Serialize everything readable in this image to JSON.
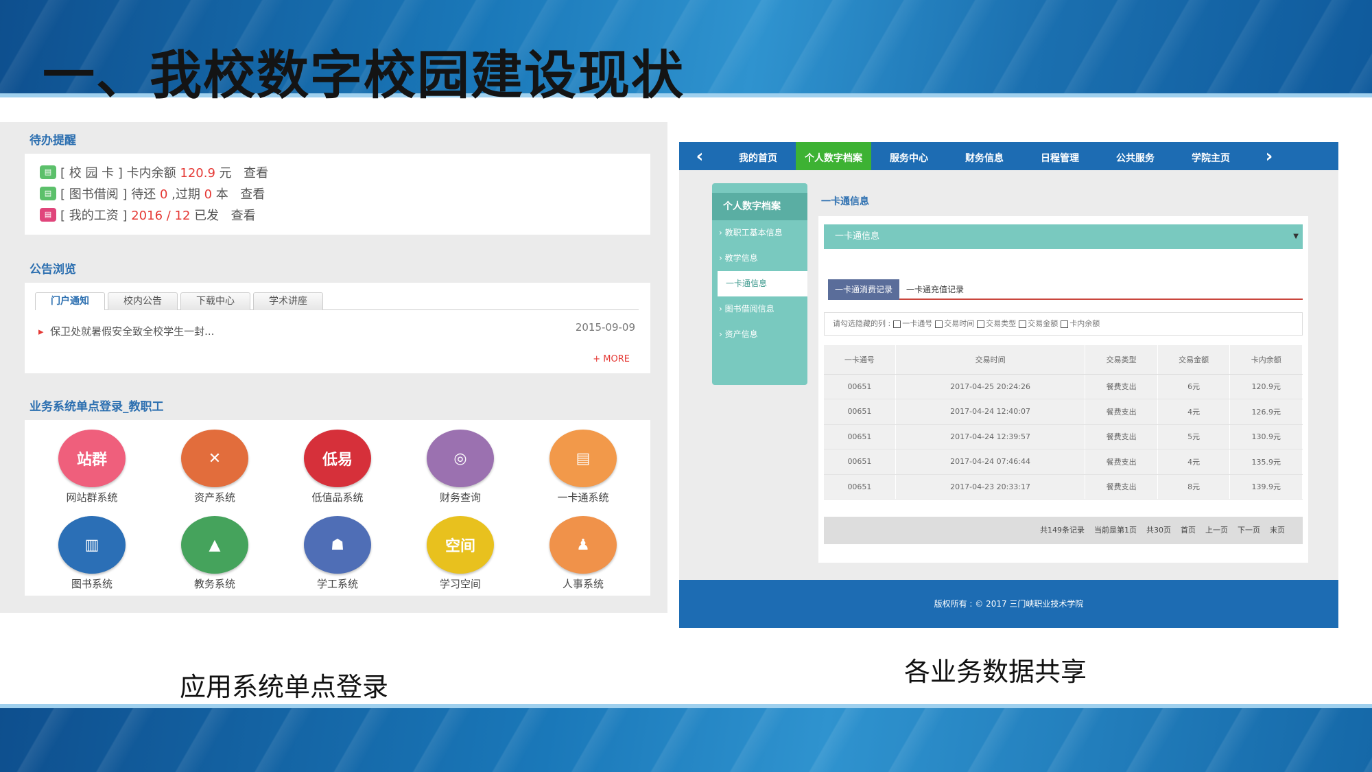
{
  "slide": {
    "title": "一、我校数字校园建设现状",
    "caption_left": "应用系统单点登录",
    "caption_right": "各业务数据共享"
  },
  "portal": {
    "todo_title": "待办提醒",
    "todos": [
      {
        "prefix": "[ 校 园 卡 ] 卡内余额 ",
        "value": "120.9",
        "suffix": " 元",
        "action": "查看",
        "icon": "card-icon",
        "color": "#5cc06b"
      },
      {
        "prefix": "[ 图书借阅 ] 待还 ",
        "value": "0",
        "mid": " ,过期 ",
        "value2": "0",
        "suffix": " 本",
        "action": "查看",
        "icon": "book-icon",
        "color": "#5cc06b"
      },
      {
        "prefix": "[ 我的工资 ] ",
        "value": "2016 / 12",
        "suffix": " 已发",
        "action": "查看",
        "icon": "salary-icon",
        "color": "#e0457b"
      }
    ],
    "notice_title": "公告浏览",
    "tabs": [
      "门户通知",
      "校内公告",
      "下载中心",
      "学术讲座"
    ],
    "notice": {
      "text": "保卫处就暑假安全致全校学生一封...",
      "date": "2015-09-09"
    },
    "more": "+ MORE",
    "apps_title": "业务系统单点登录_教职工",
    "apps": [
      {
        "label": "网站群系统",
        "glyph": "站群",
        "color": "#ef5f7c",
        "icon": "website-group-icon"
      },
      {
        "label": "资产系统",
        "glyph": "✕",
        "color": "#e26d3c",
        "icon": "tools-icon"
      },
      {
        "label": "低值品系统",
        "glyph": "低易",
        "color": "#d6303a",
        "icon": "low-value-icon"
      },
      {
        "label": "财务查询",
        "glyph": "◎",
        "color": "#9b71b0",
        "icon": "globe-search-icon"
      },
      {
        "label": "一卡通系统",
        "glyph": "▤",
        "color": "#f2994a",
        "icon": "card-system-icon"
      },
      {
        "label": "图书系统",
        "glyph": "▥",
        "color": "#2b6fb6",
        "icon": "library-icon"
      },
      {
        "label": "教务系统",
        "glyph": "▲",
        "color": "#45a35c",
        "icon": "graduation-cap-icon"
      },
      {
        "label": "学工系统",
        "glyph": "☗",
        "color": "#4f6eb6",
        "icon": "student-affairs-icon"
      },
      {
        "label": "学习空间",
        "glyph": "空间",
        "color": "#e8c11e",
        "icon": "learning-space-icon"
      },
      {
        "label": "人事系统",
        "glyph": "♟",
        "color": "#f0924a",
        "icon": "personnel-icon"
      }
    ]
  },
  "system": {
    "nav": [
      "我的首页",
      "个人数字档案",
      "服务中心",
      "财务信息",
      "日程管理",
      "公共服务",
      "学院主页"
    ],
    "nav_active": 1,
    "side_head": "个人数字档案",
    "side_items": [
      "› 教职工基本信息",
      "› 教学信息",
      "一卡通信息",
      "› 图书借阅信息",
      "› 资产信息"
    ],
    "side_active": 2,
    "crumb": "一卡通信息",
    "select": "一卡通信息",
    "subtabs": [
      "一卡通消费记录",
      "一卡通充值记录"
    ],
    "colsel_label": "请勾选隐藏的列 :",
    "colsel_options": [
      "一卡通号",
      "交易时间",
      "交易类型",
      "交易金额",
      "卡内余额"
    ],
    "headers": [
      "一卡通号",
      "交易时间",
      "交易类型",
      "交易金额",
      "卡内余额"
    ],
    "rows": [
      [
        "00651",
        "2017-04-25 20:24:26",
        "餐费支出",
        "6元",
        "120.9元"
      ],
      [
        "00651",
        "2017-04-24 12:40:07",
        "餐费支出",
        "4元",
        "126.9元"
      ],
      [
        "00651",
        "2017-04-24 12:39:57",
        "餐费支出",
        "5元",
        "130.9元"
      ],
      [
        "00651",
        "2017-04-24 07:46:44",
        "餐费支出",
        "4元",
        "135.9元"
      ],
      [
        "00651",
        "2017-04-23 20:33:17",
        "餐费支出",
        "8元",
        "139.9元"
      ]
    ],
    "pager": [
      "共149条记录",
      "当前是第1页",
      "共30页",
      "首页",
      "上一页",
      "下一页",
      "末页"
    ],
    "footer": "版权所有 : © 2017 三门峡职业技术学院"
  }
}
